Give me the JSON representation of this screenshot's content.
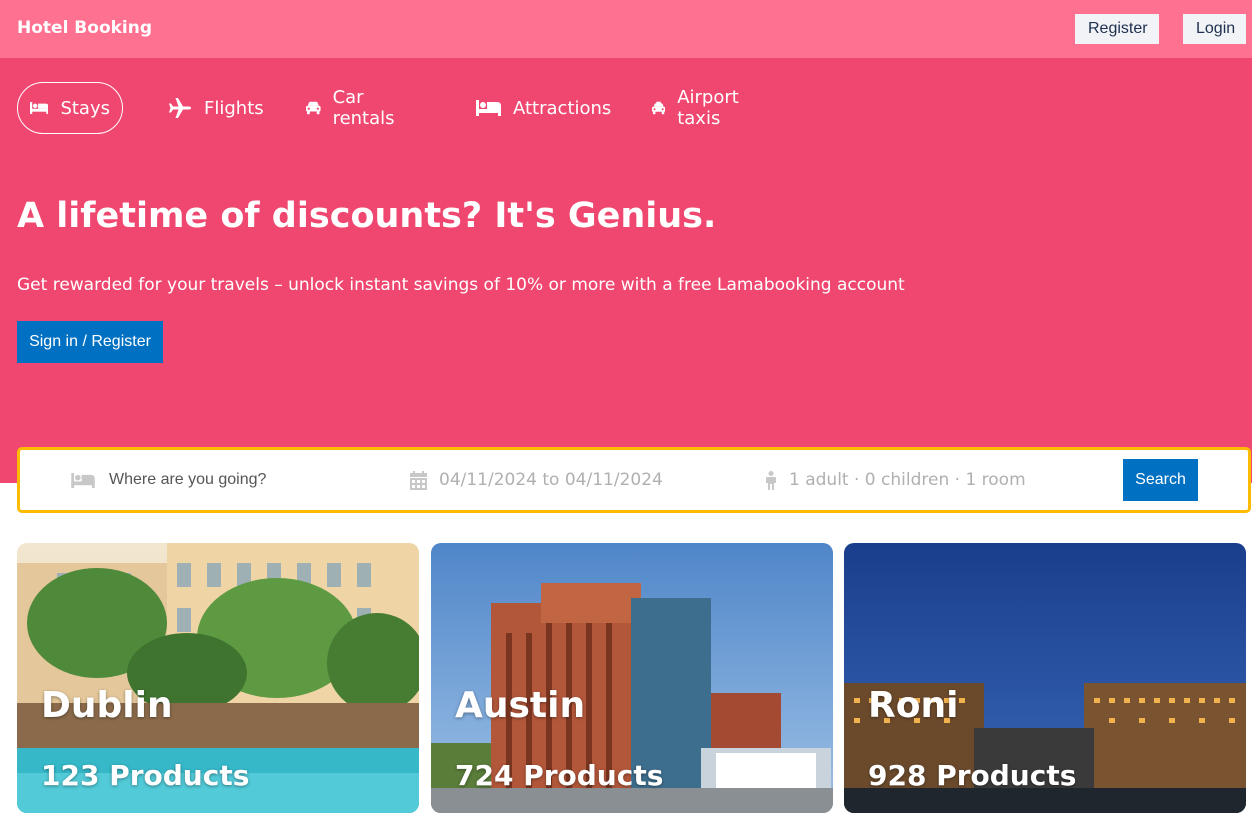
{
  "navbar": {
    "brand": "Hotel Booking",
    "register_label": "Register",
    "login_label": "Login"
  },
  "tabs": [
    {
      "label": "Stays",
      "icon": "bed-icon",
      "active": true
    },
    {
      "label": "Flights",
      "icon": "plane-icon",
      "active": false
    },
    {
      "label": "Car rentals",
      "icon": "car-icon",
      "active": false
    },
    {
      "label": "Attractions",
      "icon": "bed-icon",
      "active": false
    },
    {
      "label": "Airport taxis",
      "icon": "taxi-icon",
      "active": false
    }
  ],
  "hero": {
    "title": "A lifetime of discounts? It's Genius.",
    "description": "Get rewarded for your travels – unlock instant savings of 10% or more with a free Lamabooking account",
    "button_label": "Sign in / Register"
  },
  "search": {
    "destination_placeholder": "Where are you going?",
    "dates": "04/11/2024 to 04/11/2024",
    "options": "1 adult · 0 children · 1 room",
    "button_label": "Search"
  },
  "featured": [
    {
      "city": "Dublin",
      "count": "123 Products"
    },
    {
      "city": "Austin",
      "count": "724 Products"
    },
    {
      "city": "Roni",
      "count": "928 Products"
    }
  ],
  "colors": {
    "navbar": "#ff7191",
    "hero": "#ef476f",
    "primary_button": "#0071c2",
    "search_border": "#febb02"
  }
}
